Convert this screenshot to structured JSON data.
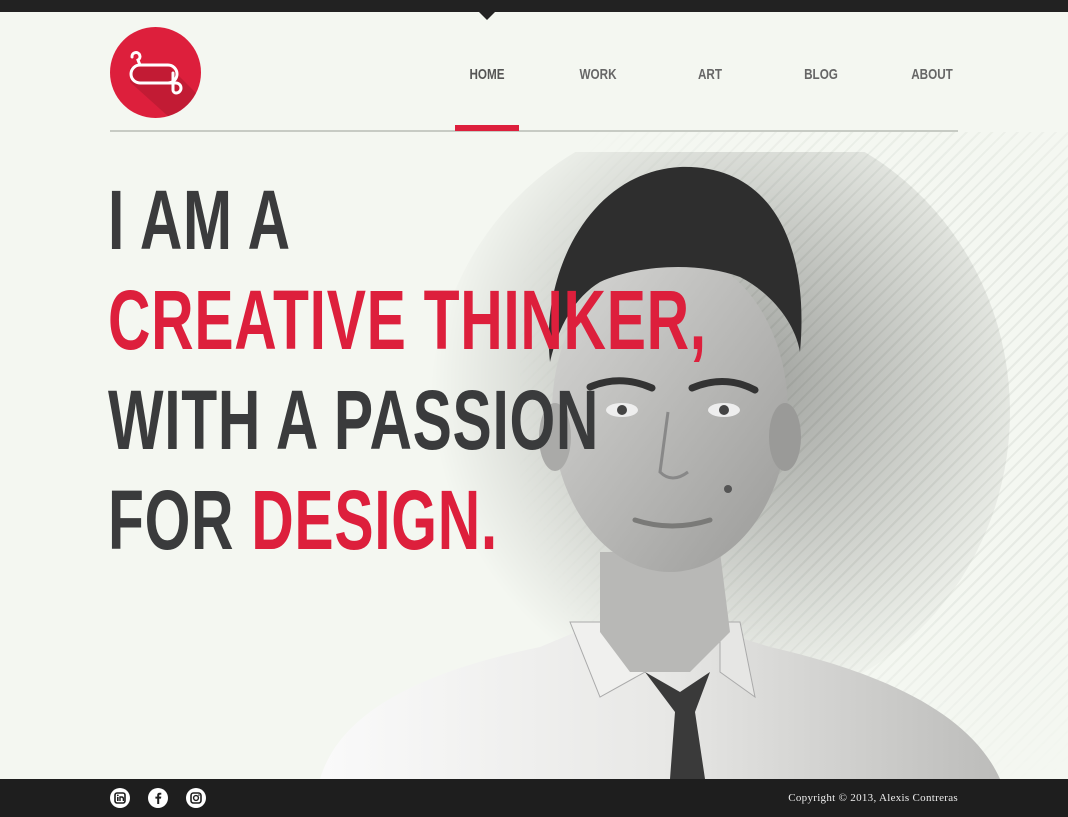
{
  "nav": {
    "items": [
      {
        "label": "HOME",
        "active": true
      },
      {
        "label": "WORK",
        "active": false
      },
      {
        "label": "ART",
        "active": false
      },
      {
        "label": "BLOG",
        "active": false
      },
      {
        "label": "ABOUT",
        "active": false
      }
    ]
  },
  "logo": {
    "icon": "monogram-logo-icon",
    "color": "#dd1f3c"
  },
  "hero": {
    "line1": "I AM A",
    "line2": "CREATIVE THINKER,",
    "line3": "WITH A PASSION",
    "line4_a": "FOR ",
    "line4_b": "DESIGN.",
    "photo": "portrait-photo"
  },
  "footer": {
    "social": [
      {
        "name": "linkedin-icon"
      },
      {
        "name": "facebook-icon"
      },
      {
        "name": "instagram-icon"
      }
    ],
    "copyright": "Copyright  © 2013, Alexis Contreras"
  },
  "colors": {
    "accent": "#dd1f3c",
    "text": "#3a3b3c",
    "bar": "#1e1e1e",
    "background": "#f4f7f1"
  }
}
